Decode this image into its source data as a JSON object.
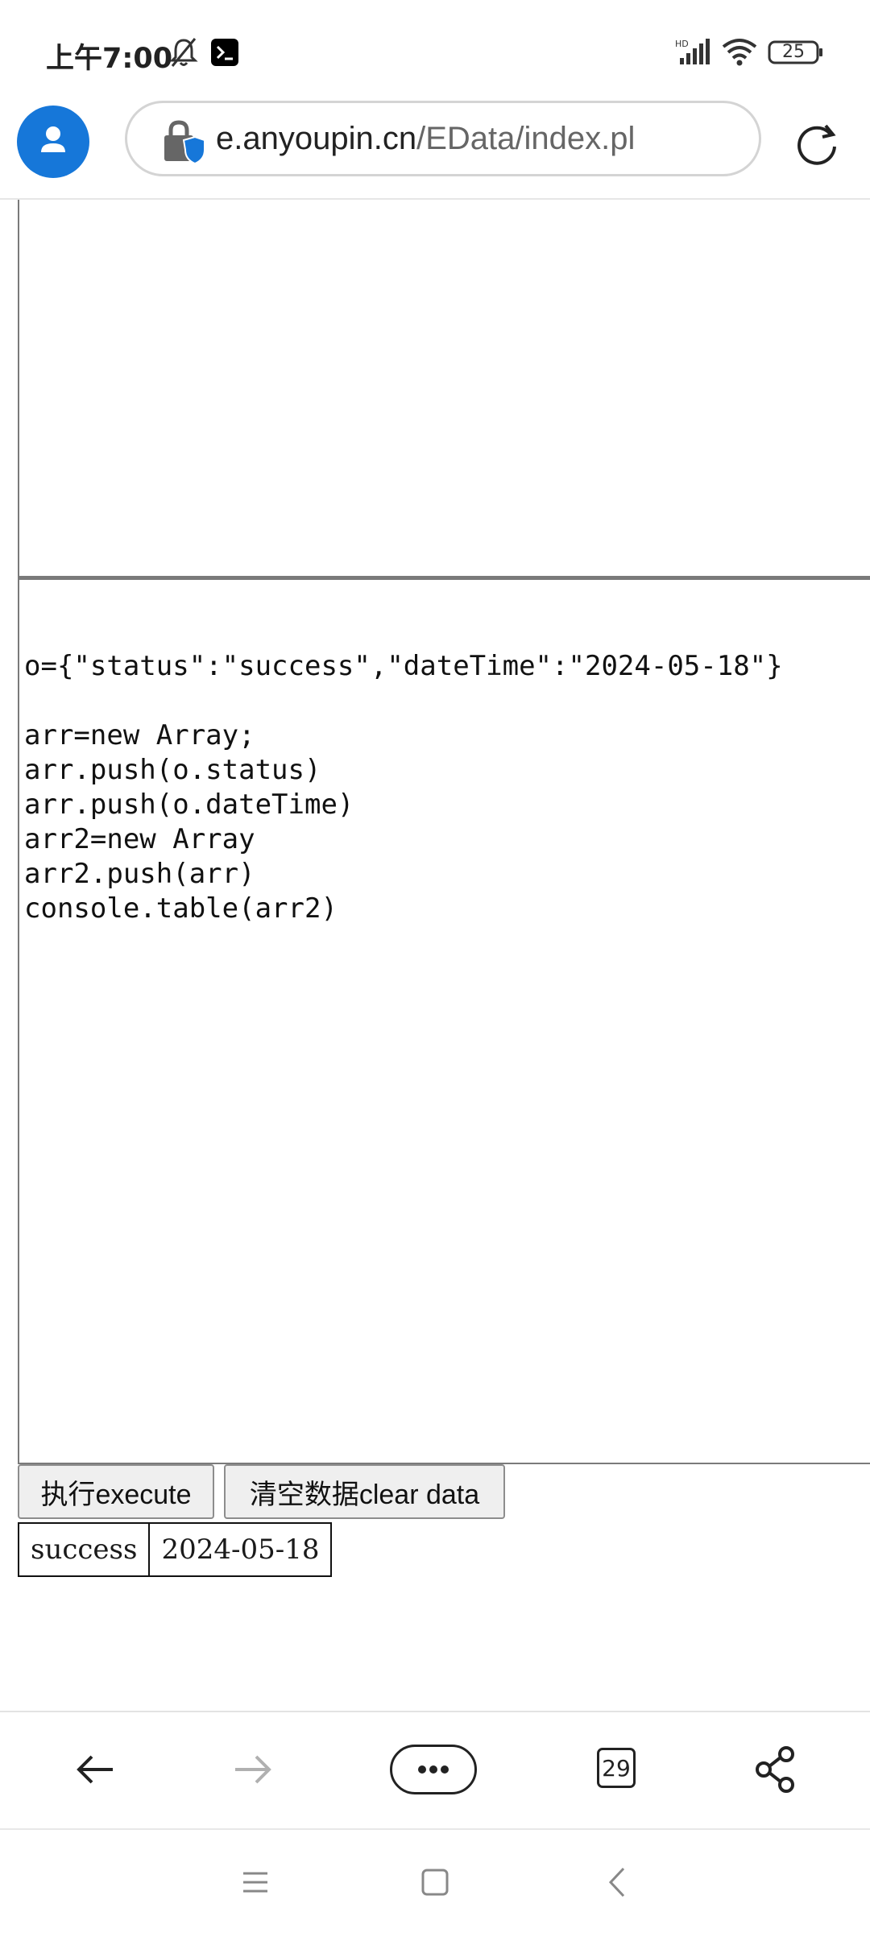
{
  "status_bar": {
    "time": "上午7:00",
    "battery": "25",
    "icons": [
      "bell-off-icon",
      "terminal-icon",
      "signal-icon",
      "wifi-icon",
      "battery-icon"
    ]
  },
  "address_bar": {
    "domain": "e.anyoupin.cn",
    "path": "/EData/index.pl",
    "icons": [
      "avatar-icon",
      "lock-shield-icon",
      "reload-icon"
    ]
  },
  "code": {
    "lines": [
      "",
      "",
      "o={\"status\":\"success\",\"dateTime\":\"2024-05-18\"}",
      "",
      "arr=new Array;",
      "arr.push(o.status)",
      "arr.push(o.dateTime)",
      "arr2=new Array",
      "arr2.push(arr)",
      "console.table(arr2)"
    ]
  },
  "buttons": {
    "execute": "执行execute",
    "clear": "清空数据clear data"
  },
  "output_table": {
    "rows": [
      [
        "success",
        "2024-05-18"
      ]
    ]
  },
  "bottom_bar": {
    "tab_count": "29",
    "icons": [
      "back-arrow-icon",
      "forward-arrow-icon",
      "more-menu-icon",
      "tabs-icon",
      "share-icon"
    ]
  },
  "system_nav": {
    "icons": [
      "recents-icon",
      "home-icon",
      "system-back-icon"
    ]
  },
  "colors": {
    "accent": "#1677d9",
    "disabled": "#b0b0b0"
  }
}
